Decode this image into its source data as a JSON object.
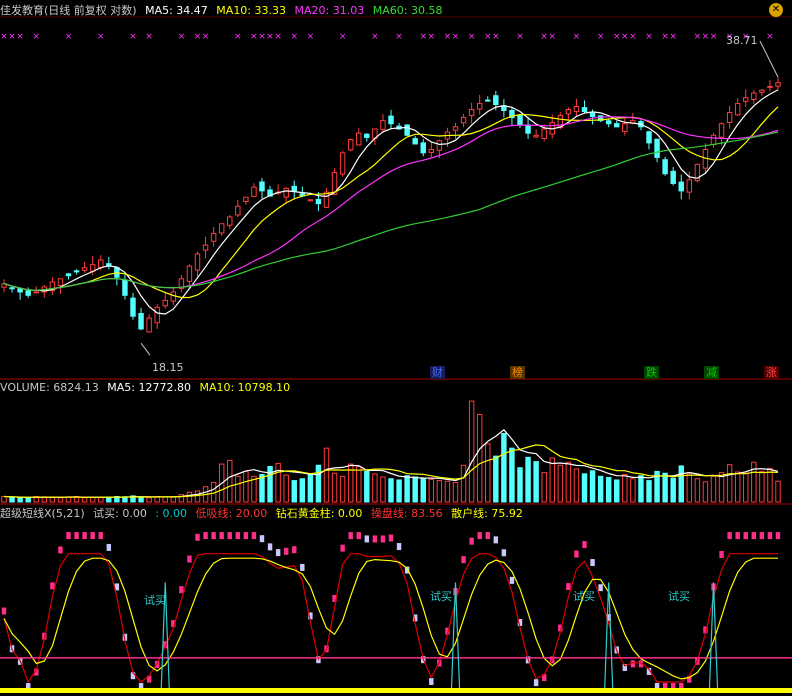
{
  "header": {
    "title": "佳发教育(日线 前复权 对数)",
    "ma5_label": "MA5: 34.47",
    "ma10_label": "MA10: 33.33",
    "ma20_label": "MA20: 31.03",
    "ma60_label": "MA60: 30.58",
    "colors": {
      "ma5": "#ffffff",
      "ma10": "#ffff00",
      "ma20": "#ff00ff",
      "ma60": "#00cc00"
    }
  },
  "price_labels": {
    "high": "38.71",
    "low": "18.15"
  },
  "events": [
    {
      "label": "财",
      "color": "#3b6cff"
    },
    {
      "label": "榜",
      "color": "#ff8800"
    },
    {
      "label": "跌",
      "color": "#00cc00"
    },
    {
      "label": "减",
      "color": "#00cc00"
    },
    {
      "label": "涨",
      "color": "#ff4444"
    }
  ],
  "volume_header": {
    "volume": "VOLUME: 6824.13",
    "ma5": "MA5: 12772.80",
    "ma10": "MA10: 10798.10"
  },
  "indicator_header": {
    "name": "超级短线X(5,21)",
    "trial_buy": "试买: 0.00",
    "zero": ": 0.00",
    "low_absorb": "低吸线: 20.00",
    "golden_pillar": "钻石黄金柱: 0.00",
    "control_line": "操盘线: 83.56",
    "retail_line": "散户线: 75.92"
  },
  "signal_label": "试买",
  "chart_data": {
    "type": "candlestick",
    "title": "佳发教育(日线 前复权 对数)",
    "x": "trading days (unlabeled)",
    "price": {
      "low_marker": 18.15,
      "high_marker": 38.71,
      "close_approx": [
        21.5,
        21.2,
        21.0,
        20.8,
        21.0,
        21.3,
        21.6,
        21.8,
        22.0,
        22.3,
        22.5,
        22.7,
        23.0,
        22.6,
        21.9,
        20.8,
        19.6,
        18.9,
        19.5,
        20.1,
        20.5,
        21.0,
        21.8,
        22.6,
        23.4,
        24.0,
        24.8,
        25.5,
        26.0,
        26.8,
        27.5,
        28.3,
        28.0,
        27.6,
        27.9,
        28.2,
        28.0,
        27.6,
        27.3,
        27.0,
        27.9,
        29.5,
        31.2,
        32.4,
        33.0,
        32.6,
        33.4,
        34.2,
        33.9,
        33.4,
        32.8,
        32.0,
        31.2,
        31.5,
        32.3,
        33.1,
        33.6,
        34.5,
        35.3,
        35.9,
        36.2,
        35.8,
        35.2,
        34.5,
        33.8,
        33.0,
        32.8,
        33.4,
        34.0,
        34.7,
        35.3,
        35.6,
        35.1,
        34.6,
        34.2,
        33.9,
        33.6,
        33.9,
        34.2,
        33.6,
        32.1,
        30.8,
        29.4,
        28.6,
        28.0,
        28.9,
        30.2,
        31.5,
        32.8,
        33.9,
        35.0,
        35.9,
        36.5,
        37.0,
        37.3,
        37.7,
        38.1
      ],
      "ma_last": {
        "MA5": 34.47,
        "MA10": 33.33,
        "MA20": 31.03,
        "MA60": 30.58
      }
    },
    "volume": {
      "last": 6824.13,
      "ma5": 12772.8,
      "ma10": 10798.1,
      "values_approx": [
        900,
        800,
        700,
        600,
        900,
        850,
        800,
        700,
        800,
        900,
        700,
        800,
        750,
        800,
        900,
        850,
        1000,
        800,
        700,
        900,
        800,
        900,
        1200,
        1600,
        1800,
        2500,
        3200,
        6200,
        6800,
        4200,
        5000,
        4200,
        4500,
        5800,
        6300,
        4400,
        3500,
        3800,
        4600,
        6000,
        8800,
        4700,
        4200,
        6200,
        5800,
        5000,
        4600,
        4100,
        3800,
        3600,
        4300,
        4100,
        3800,
        3700,
        3500,
        3400,
        3200,
        6000,
        16500,
        14300,
        9500,
        7500,
        11200,
        8800,
        5600,
        7300,
        6600,
        4800,
        7200,
        6000,
        6500,
        5400,
        4600,
        5100,
        4200,
        4000,
        3600,
        4500,
        3800,
        4300,
        3500,
        5000,
        4700,
        3900,
        5900,
        4600,
        3800,
        3300,
        4200,
        4800,
        6100,
        4900,
        4700,
        6500,
        5000,
        5500,
        3400
      ]
    },
    "indicator": {
      "name": "超级短线X(5,21)",
      "trial_buy": 0.0,
      "low_absorb_line": 20.0,
      "golden_pillar": 0.0,
      "control_line": 83.56,
      "retail_line": 75.92
    }
  }
}
